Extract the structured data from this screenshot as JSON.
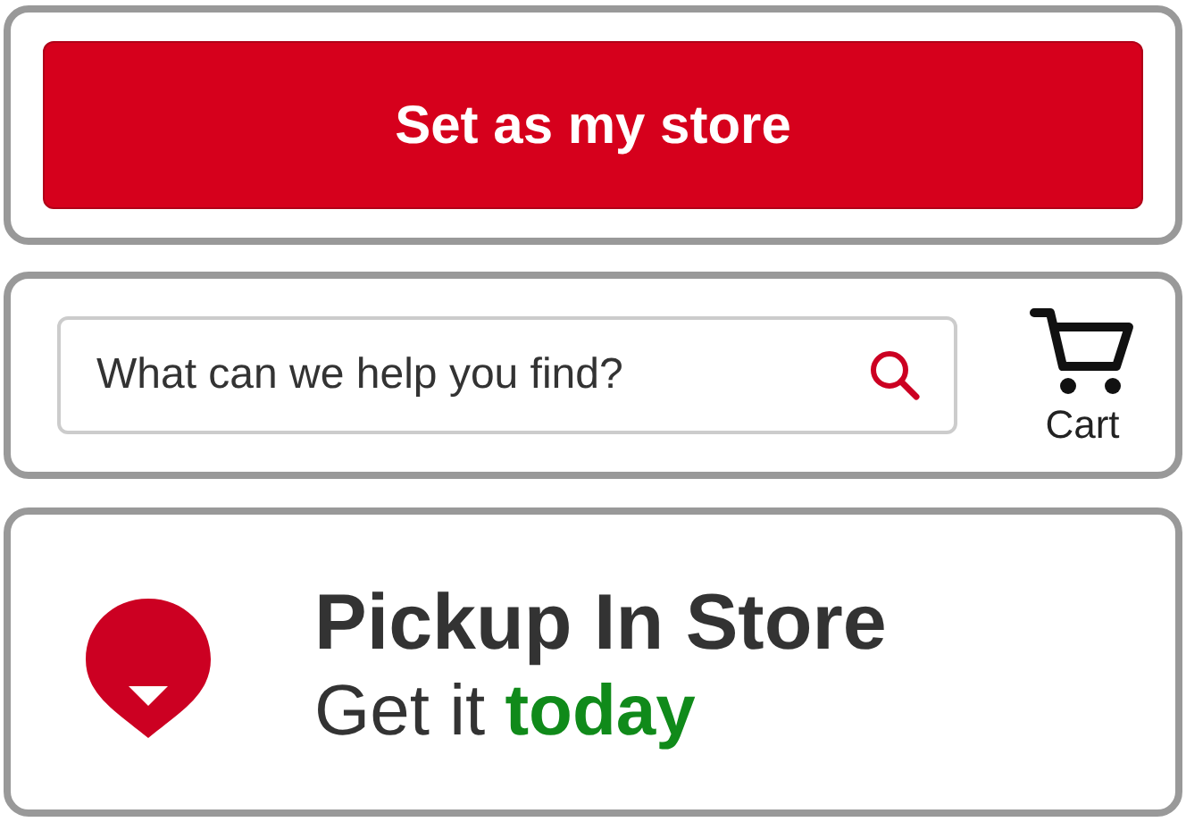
{
  "store_button": {
    "label": "Set as my store"
  },
  "search": {
    "placeholder": "What can we help you find?"
  },
  "cart": {
    "label": "Cart"
  },
  "pickup": {
    "title": "Pickup In Store",
    "subtitle": "Get it **today**"
  }
}
